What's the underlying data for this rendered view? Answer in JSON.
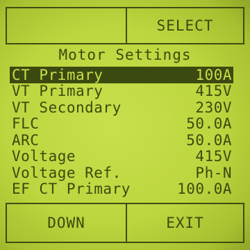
{
  "softkeys_top": {
    "left_label": "",
    "right_label": "SELECT"
  },
  "title": "Motor Settings",
  "settings": [
    {
      "label": "CT Primary",
      "value": "100A",
      "selected": true
    },
    {
      "label": "VT Primary",
      "value": "415V",
      "selected": false
    },
    {
      "label": "VT Secondary",
      "value": "230V",
      "selected": false
    },
    {
      "label": "FLC",
      "value": "50.0A",
      "selected": false
    },
    {
      "label": "ARC",
      "value": "50.0A",
      "selected": false
    },
    {
      "label": "Voltage",
      "value": "415V",
      "selected": false
    },
    {
      "label": "Voltage Ref.",
      "value": "Ph-N",
      "selected": false
    },
    {
      "label": "EF CT Primary",
      "value": "100.0A",
      "selected": false
    }
  ],
  "softkeys_bottom": {
    "left_label": "DOWN",
    "right_label": "EXIT"
  },
  "colors": {
    "lcd_background": "#bcd63f",
    "lcd_ink": "#3a4a0e",
    "selection_background": "#3b4a10"
  }
}
